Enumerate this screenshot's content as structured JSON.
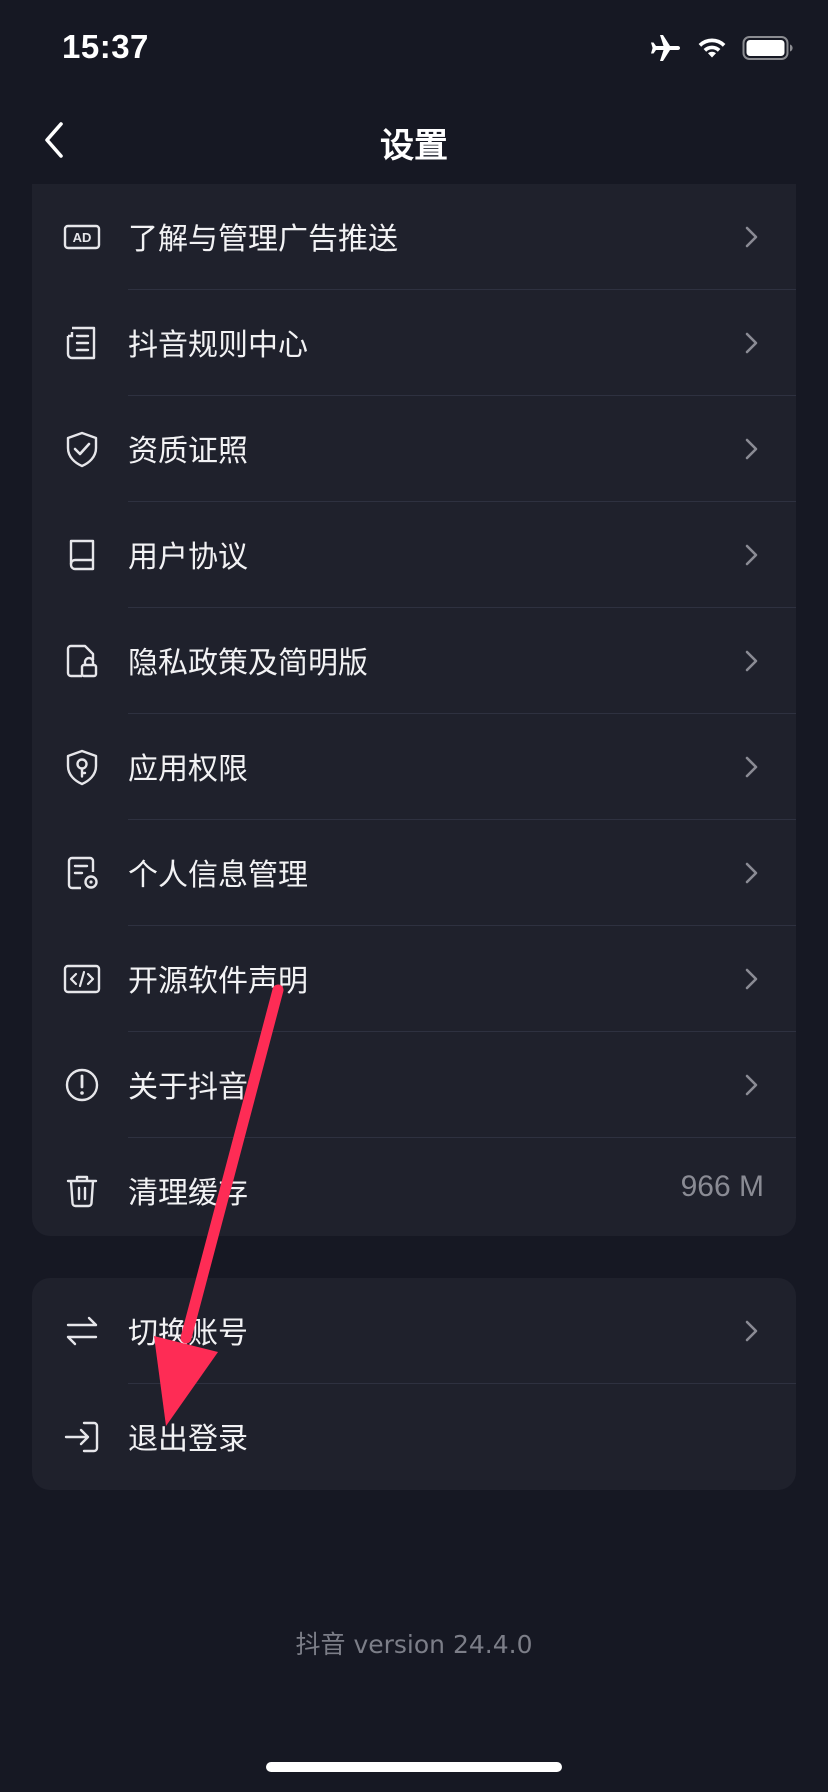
{
  "status_bar": {
    "time": "15:37",
    "icons": [
      "airplane-icon",
      "wifi-icon",
      "battery-icon"
    ]
  },
  "nav": {
    "title": "设置",
    "back_icon": "chevron-left-icon"
  },
  "menu": {
    "items": [
      {
        "icon": "ad-icon",
        "label": "了解与管理广告推送"
      },
      {
        "icon": "document-list-icon",
        "label": "抖音规则中心"
      },
      {
        "icon": "shield-check-icon",
        "label": "资质证照"
      },
      {
        "icon": "book-icon",
        "label": "用户协议"
      },
      {
        "icon": "privacy-lock-icon",
        "label": "隐私政策及简明版"
      },
      {
        "icon": "shield-key-icon",
        "label": "应用权限"
      },
      {
        "icon": "personal-info-icon",
        "label": "个人信息管理"
      },
      {
        "icon": "code-icon",
        "label": "开源软件声明"
      },
      {
        "icon": "info-circle-icon",
        "label": "关于抖音"
      },
      {
        "icon": "trash-icon",
        "label": "清理缓存",
        "value": "966 M"
      }
    ]
  },
  "account": {
    "items": [
      {
        "icon": "switch-arrows-icon",
        "label": "切换账号"
      },
      {
        "icon": "logout-icon",
        "label": "退出登录"
      }
    ]
  },
  "footer": {
    "version": "抖音 version 24.4.0"
  },
  "colors": {
    "background": "#161823",
    "card": "#1f212c",
    "annotation_arrow": "#fe2c55"
  }
}
